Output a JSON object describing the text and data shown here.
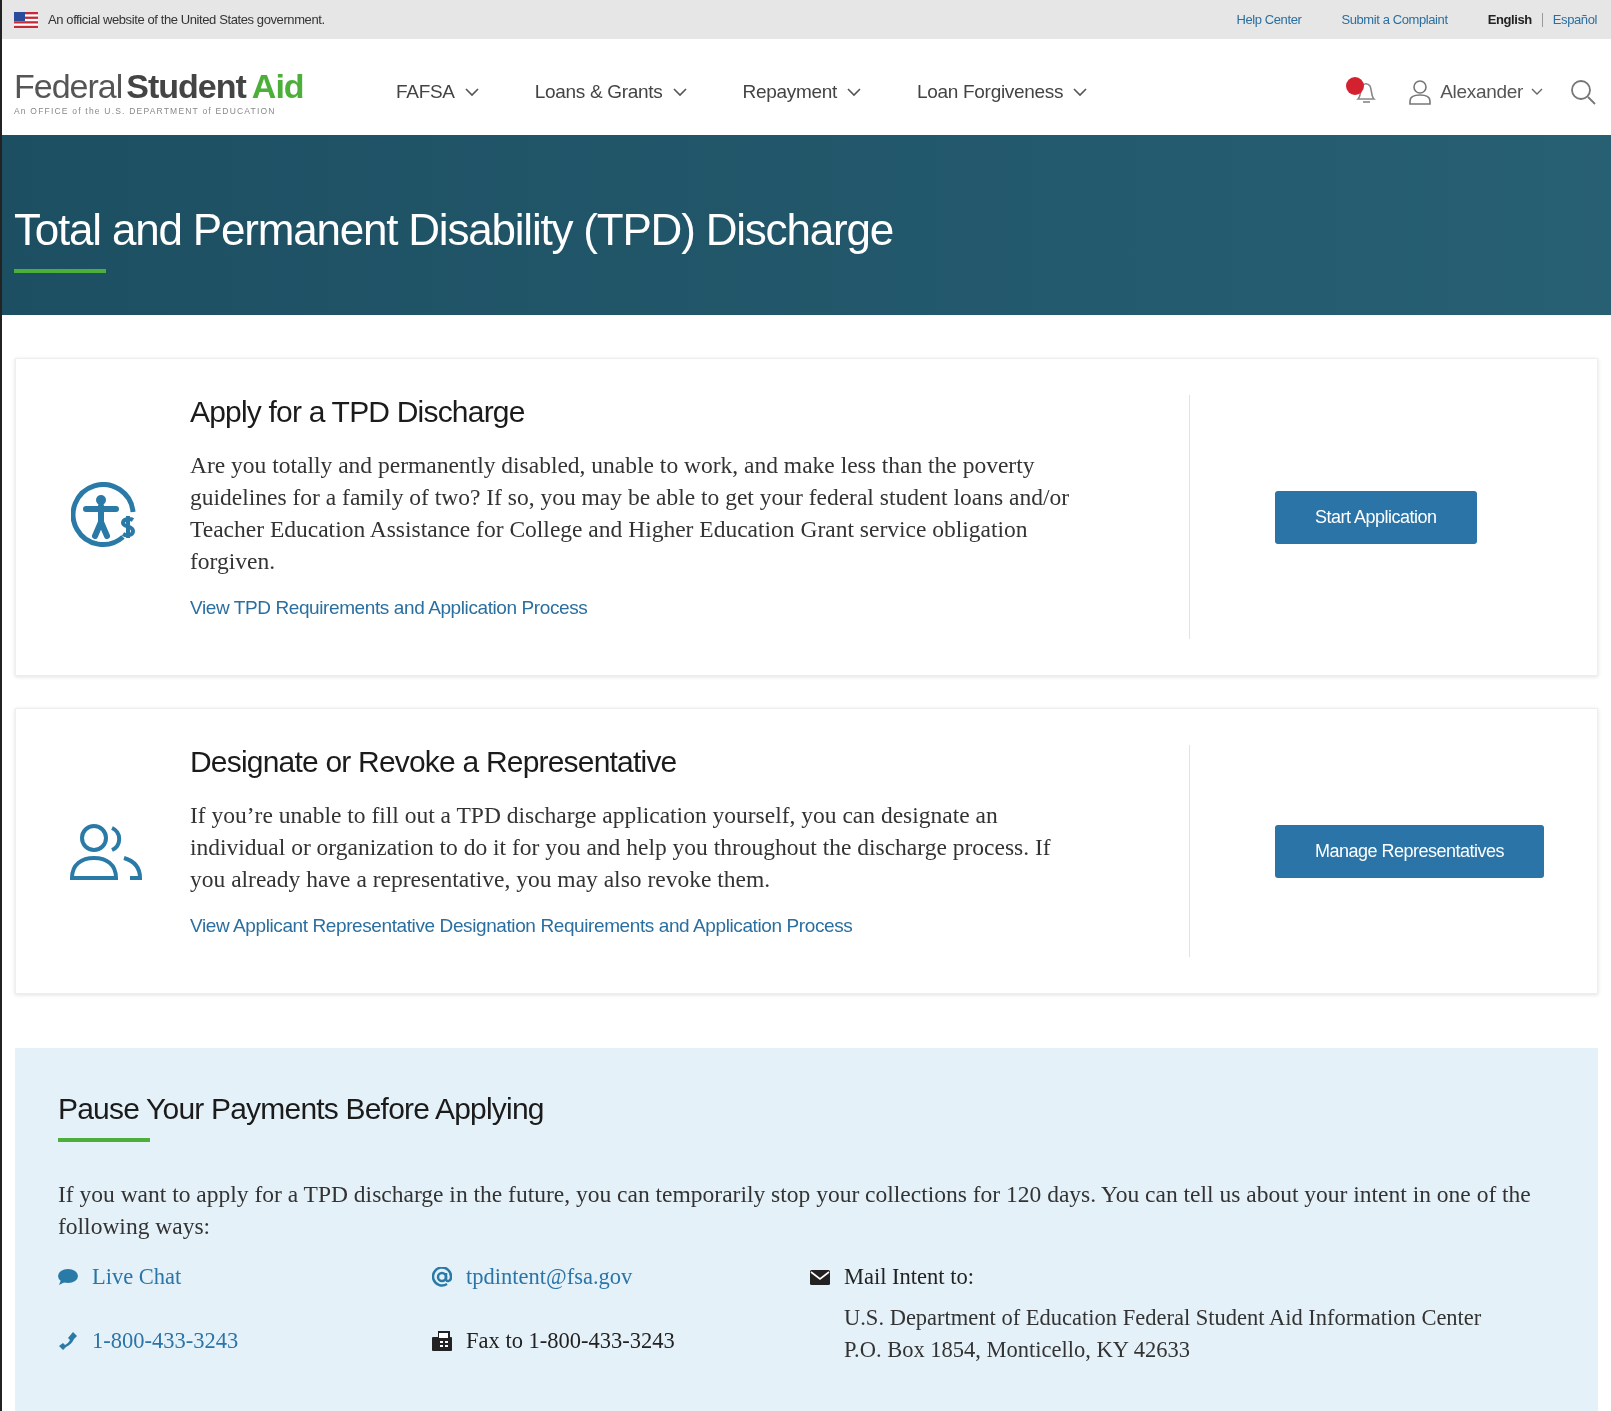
{
  "gov_banner": {
    "text": "An official website of the United States government.",
    "links": [
      "Help Center",
      "Submit a Complaint"
    ],
    "languages": [
      {
        "label": "English",
        "selected": true
      },
      {
        "label": "Español",
        "selected": false
      }
    ]
  },
  "header": {
    "logo": {
      "light": "Federal",
      "bold": "Student",
      "accent": "Aid",
      "tagline": "An OFFICE of the U.S. DEPARTMENT of EDUCATION"
    },
    "nav": [
      {
        "label": "FAFSA"
      },
      {
        "label": "Loans & Grants"
      },
      {
        "label": "Repayment"
      },
      {
        "label": "Loan Forgiveness"
      }
    ],
    "notifications": {
      "unread": true
    },
    "user": "Alexander"
  },
  "hero": {
    "title": "Total and Permanent Disability (TPD) Discharge"
  },
  "cards": [
    {
      "kind": "disability",
      "title": "Apply for a TPD Discharge",
      "text": "Are you totally and permanently disabled, unable to work, and make less than the poverty guidelines for a family of two? If so, you may be able to get your federal student loans and/or Teacher Education Assistance for College and Higher Education Grant service obligation forgiven.",
      "link": "View TPD Requirements and Application Process",
      "button": "Start Application"
    },
    {
      "kind": "people",
      "title": "Designate or Revoke a Representative",
      "text": "If you’re unable to fill out a TPD discharge application yourself, you can designate an individual or organization to do it for you and help you throughout the discharge process. If you already have a representative, you may also revoke them.",
      "link": "View Applicant Representative Designation Requirements and Application Process",
      "button": "Manage Representatives"
    }
  ],
  "pause": {
    "title": "Pause Your Payments Before Applying",
    "text": "If you want to apply for a TPD discharge in the future, you can temporarily stop your collections for 120 days. You can tell us about your intent in one of the following ways:",
    "contacts": [
      {
        "kind": "chat",
        "label": "Live Chat",
        "link": true
      },
      {
        "kind": "email",
        "label": "tpdintent@fsa.gov",
        "link": true
      },
      {
        "kind": "mail",
        "label": "Mail Intent to:",
        "link": false,
        "lines": [
          "U.S. Department of Education Federal Student Aid Information Center",
          "P.O. Box 1854, Monticello, KY 42633"
        ]
      },
      {
        "kind": "phone",
        "label": "1-800-433-3243",
        "link": true
      },
      {
        "kind": "fax",
        "label": "Fax to 1-800-433-3243",
        "link": false
      }
    ]
  }
}
